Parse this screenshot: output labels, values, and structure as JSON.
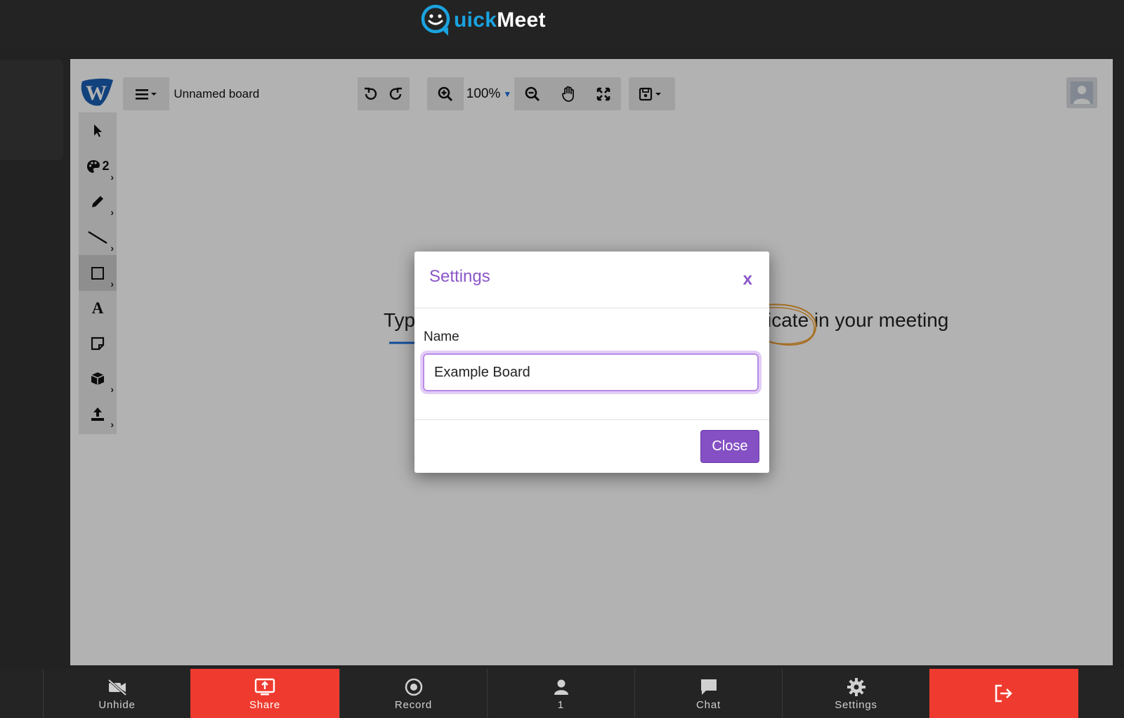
{
  "header": {
    "logo_part1": "uick",
    "logo_part2": "Meet",
    "colors": {
      "logo_blue": "#1aa3e0",
      "background": "#232323"
    }
  },
  "whiteboard": {
    "board_name": "Unnamed board",
    "zoom_level": "100%",
    "tools": [
      {
        "name": "cursor-icon",
        "label": ""
      },
      {
        "name": "palette-icon",
        "label": "2"
      },
      {
        "name": "pencil-icon",
        "label": ""
      },
      {
        "name": "line-icon",
        "label": ""
      },
      {
        "name": "rectangle-icon",
        "label": ""
      },
      {
        "name": "text-icon",
        "label": "A"
      },
      {
        "name": "sticky-note-icon",
        "label": ""
      },
      {
        "name": "cube-icon",
        "label": ""
      },
      {
        "name": "upload-icon",
        "label": ""
      }
    ],
    "more_indicator": "›",
    "canvas_text_left": "Typ",
    "canvas_text_right": "icate in your meeting"
  },
  "modal": {
    "title": "Settings",
    "close_x": "x",
    "name_label": "Name",
    "name_value": "Example Board",
    "close_button": "Close",
    "colors": {
      "accent": "#8450c4"
    }
  },
  "bottombar": {
    "items": [
      {
        "label": "Unhide",
        "icon": "video-off-icon"
      },
      {
        "label": "Share",
        "icon": "screen-share-icon"
      },
      {
        "label": "Record",
        "icon": "record-icon"
      },
      {
        "label": "1",
        "icon": "person-icon"
      },
      {
        "label": "Chat",
        "icon": "chat-icon"
      },
      {
        "label": "Settings",
        "icon": "gear-icon"
      },
      {
        "label": "",
        "icon": "exit-icon"
      }
    ],
    "colors": {
      "active": "#ef3b2f"
    }
  }
}
